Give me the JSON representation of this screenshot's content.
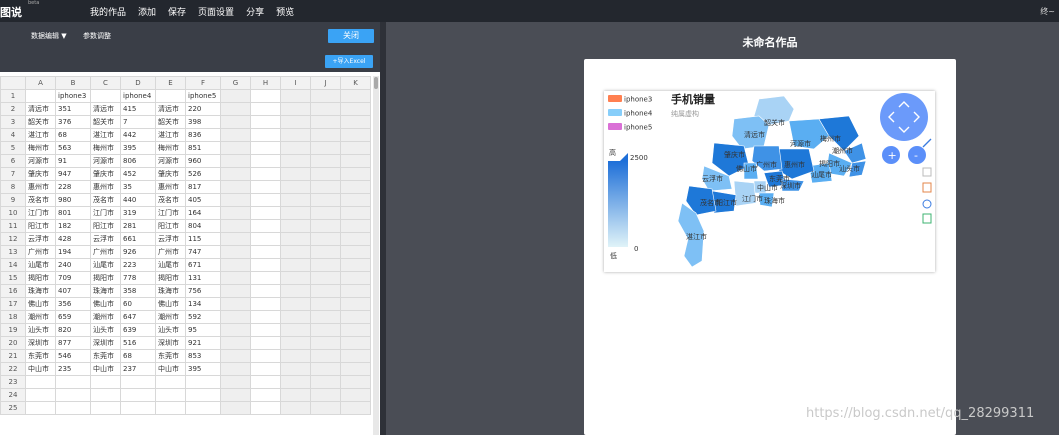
{
  "app": {
    "logo": "图说",
    "logo_badge": "beta",
    "menu": [
      "我的作品",
      "添加",
      "保存",
      "页面设置",
      "分享",
      "预览"
    ],
    "user_label": "终~"
  },
  "editor": {
    "data_edit_label": "数据编辑 ▼",
    "param_label": "参数调整",
    "close_label": "关闭",
    "import_label": "+导入Excel"
  },
  "sheet": {
    "columns": [
      "A",
      "B",
      "C",
      "D",
      "E",
      "F",
      "G",
      "H",
      "I",
      "J",
      "K"
    ],
    "rows": [
      [
        "",
        "iphone3",
        "",
        "iphone4",
        "",
        "iphone5"
      ],
      [
        "清远市",
        "351",
        "清远市",
        "415",
        "清远市",
        "220"
      ],
      [
        "韶关市",
        "376",
        "韶关市",
        "7",
        "韶关市",
        "398"
      ],
      [
        "湛江市",
        "68",
        "湛江市",
        "442",
        "湛江市",
        "836"
      ],
      [
        "梅州市",
        "563",
        "梅州市",
        "395",
        "梅州市",
        "851"
      ],
      [
        "河源市",
        "91",
        "河源市",
        "806",
        "河源市",
        "960"
      ],
      [
        "肇庆市",
        "947",
        "肇庆市",
        "452",
        "肇庆市",
        "526"
      ],
      [
        "惠州市",
        "228",
        "惠州市",
        "35",
        "惠州市",
        "817"
      ],
      [
        "茂名市",
        "980",
        "茂名市",
        "440",
        "茂名市",
        "405"
      ],
      [
        "江门市",
        "801",
        "江门市",
        "319",
        "江门市",
        "164"
      ],
      [
        "阳江市",
        "182",
        "阳江市",
        "281",
        "阳江市",
        "804"
      ],
      [
        "云浮市",
        "428",
        "云浮市",
        "661",
        "云浮市",
        "115"
      ],
      [
        "广州市",
        "194",
        "广州市",
        "926",
        "广州市",
        "747"
      ],
      [
        "汕尾市",
        "240",
        "汕尾市",
        "223",
        "汕尾市",
        "671"
      ],
      [
        "揭阳市",
        "709",
        "揭阳市",
        "778",
        "揭阳市",
        "131"
      ],
      [
        "珠海市",
        "407",
        "珠海市",
        "358",
        "珠海市",
        "756"
      ],
      [
        "佛山市",
        "356",
        "佛山市",
        "60",
        "佛山市",
        "134"
      ],
      [
        "潮州市",
        "659",
        "潮州市",
        "647",
        "潮州市",
        "592"
      ],
      [
        "汕头市",
        "820",
        "汕头市",
        "639",
        "汕头市",
        "95"
      ],
      [
        "深圳市",
        "877",
        "深圳市",
        "516",
        "深圳市",
        "921"
      ],
      [
        "东莞市",
        "546",
        "东莞市",
        "68",
        "东莞市",
        "853"
      ],
      [
        "中山市",
        "235",
        "中山市",
        "237",
        "中山市",
        "395"
      ],
      [],
      [],
      []
    ]
  },
  "canvas": {
    "work_title": "未命名作品"
  },
  "chart": {
    "title": "手机销量",
    "subtitle": "纯属虚构",
    "legend": [
      {
        "name": "iphone3",
        "color": "#ff7f50"
      },
      {
        "name": "iphone4",
        "color": "#87cefa"
      },
      {
        "name": "iphone5",
        "color": "#da70d6"
      }
    ],
    "visual_map": {
      "high_label": "高",
      "low_label": "低",
      "max": "2500",
      "min": "0"
    },
    "city_labels": [
      "韶关市",
      "清远市",
      "河源市",
      "梅州市",
      "潮州市",
      "肇庆市",
      "佛山市",
      "广州市",
      "惠州市",
      "揭阳市",
      "汕头市",
      "云浮市",
      "汕尾市",
      "东莞市",
      "中山市",
      "江门市",
      "深圳市",
      "珠海市",
      "阳江市",
      "茂名市",
      "湛江市"
    ],
    "map_colors": {
      "light": "#a9d3f5",
      "mid": "#5aaef2",
      "dark": "#1e78d8"
    },
    "toolbox_icons": [
      "pan-up-icon",
      "pan-down-icon",
      "pan-left-icon",
      "pan-right-icon",
      "zoom-in-icon",
      "zoom-out-icon",
      "pen-icon",
      "eraser-icon",
      "trash-icon",
      "data-view-icon",
      "restore-icon",
      "save-image-icon"
    ]
  },
  "watermark": "https://blog.csdn.net/qq_28299311"
}
